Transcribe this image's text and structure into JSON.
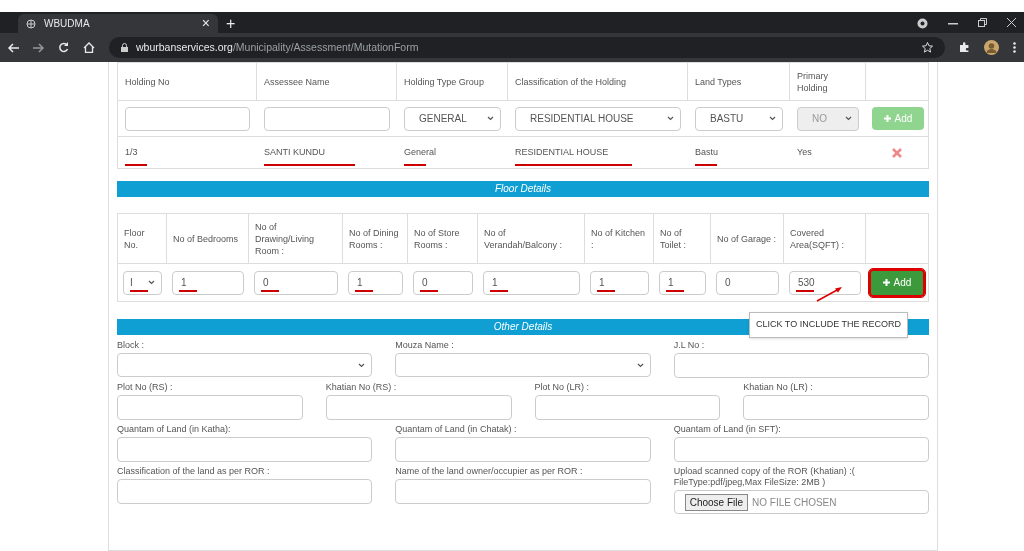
{
  "browser": {
    "tab_title": "WBUDMA",
    "tab_close": "×",
    "new_tab": "+",
    "url_domain": "wburbanservices.org",
    "url_path": "/Municipality/Assessment/MutationForm"
  },
  "holding": {
    "columns": [
      "Holding No",
      "Assessee Name",
      "Holding Type Group",
      "Classification of the Holding",
      "Land Types",
      "Primary Holding"
    ],
    "input_row": [
      {
        "kind": "input"
      },
      {
        "kind": "input"
      },
      {
        "kind": "select",
        "value": "GENERAL",
        "disabled": false
      },
      {
        "kind": "select",
        "value": "RESIDENTIAL HOUSE",
        "disabled": false
      },
      {
        "kind": "select",
        "value": "BASTU",
        "disabled": false
      },
      {
        "kind": "select",
        "value": "NO",
        "disabled": true
      }
    ],
    "add_button": {
      "label": "Add",
      "disabled": true
    },
    "rows": [
      {
        "cells": [
          {
            "text": "1/3",
            "marked": true
          },
          {
            "text": "SANTI KUNDU",
            "marked": true
          },
          {
            "text": "General",
            "marked": true
          },
          {
            "text": "RESIDENTIAL HOUSE",
            "marked": true
          },
          {
            "text": "Bastu",
            "marked": true
          },
          {
            "text": "Yes",
            "marked": false
          }
        ]
      }
    ]
  },
  "floor": {
    "title": "Floor Details",
    "columns": [
      "Floor No.",
      "No of Bedrooms",
      "No of Drawing/Living Room :",
      "No of Dining Rooms :",
      "No of Store Rooms :",
      "No of Verandah/Balcony :",
      "No of Kitchen :",
      "No of Toilet :",
      "No of Garage :",
      "Covered Area(SQFT) :"
    ],
    "inputs": [
      {
        "kind": "select",
        "value": "I",
        "marked": true
      },
      {
        "kind": "input",
        "value": "1",
        "marked": true
      },
      {
        "kind": "input",
        "value": "0",
        "marked": true
      },
      {
        "kind": "input",
        "value": "1",
        "marked": true
      },
      {
        "kind": "input",
        "value": "0",
        "marked": true
      },
      {
        "kind": "input",
        "value": "1",
        "marked": true
      },
      {
        "kind": "input",
        "value": "1",
        "marked": true
      },
      {
        "kind": "input",
        "value": "1",
        "marked": true
      },
      {
        "kind": "input",
        "value": "0",
        "marked": false
      },
      {
        "kind": "input",
        "value": "530",
        "marked": true
      }
    ],
    "add_button": {
      "label": "Add",
      "highlighted": true
    },
    "tooltip": "CLICK TO INCLUDE THE RECORD"
  },
  "other": {
    "title": "Other Details",
    "rows": [
      [
        {
          "label": "Block :",
          "kind": "select"
        },
        {
          "label": "Mouza Name :",
          "kind": "select"
        },
        {
          "label": "J.L No :",
          "kind": "input"
        }
      ],
      [
        {
          "label": "Plot No (RS) :",
          "kind": "input"
        },
        {
          "label": "Khatian No (RS) :",
          "kind": "input"
        },
        {
          "label": "Plot No (LR) :",
          "kind": "input"
        },
        {
          "label": "Khatian No (LR) :",
          "kind": "input"
        }
      ],
      [
        {
          "label": "Quantam of Land (in Katha):",
          "kind": "input"
        },
        {
          "label": "Quantam of Land (in Chatak) :",
          "kind": "input"
        },
        {
          "label": "Quantam of Land (in SFT):",
          "kind": "input"
        }
      ],
      [
        {
          "label": "Classification of the land as per ROR :",
          "kind": "input"
        },
        {
          "label": "Name of the land owner/occupier as per ROR :",
          "kind": "input"
        },
        {
          "label": "Upload scanned copy of the ROR (Khatian) :( FileType:pdf/jpeg,Max FileSize: 2MB )",
          "kind": "file",
          "button": "Choose File",
          "status": "NO FILE CHOSEN"
        }
      ]
    ]
  }
}
